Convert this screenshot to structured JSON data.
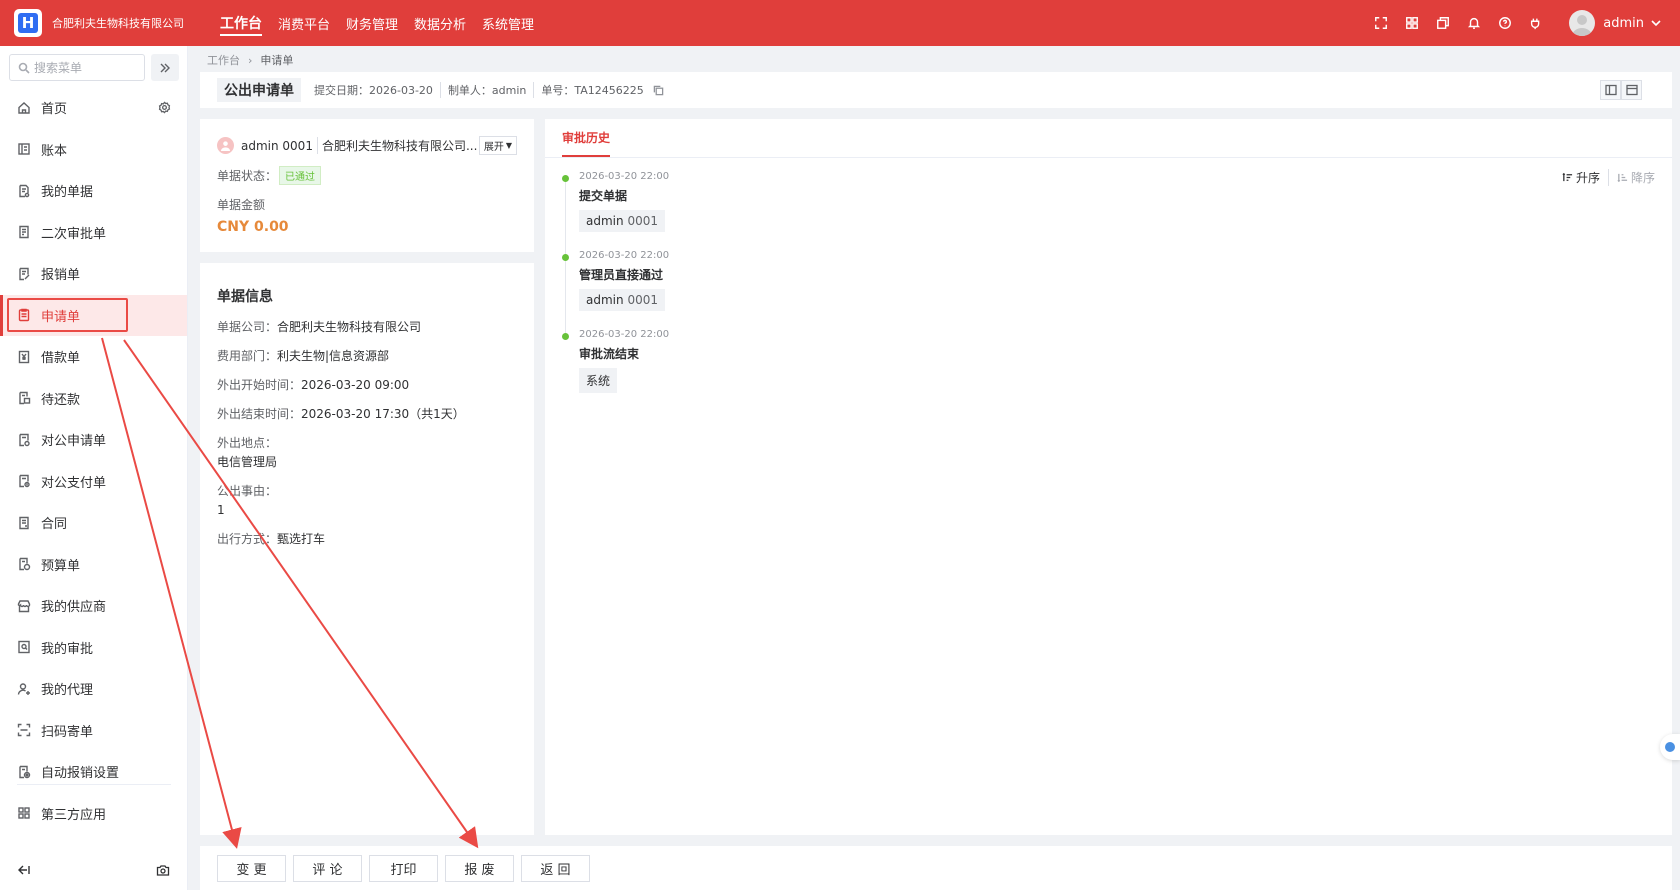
{
  "app": {
    "logo_letter": "H",
    "company": "合肥利夫生物科技有限公司",
    "top_nav": [
      {
        "label": "工作台",
        "active": true
      },
      {
        "label": "消费平台"
      },
      {
        "label": "财务管理"
      },
      {
        "label": "数据分析"
      },
      {
        "label": "系统管理"
      }
    ],
    "top_icons": [
      "fullscreen-icon",
      "apps-grid-icon",
      "windows-icon",
      "bell-icon",
      "help-icon",
      "plugin-icon"
    ],
    "user": "admin",
    "brand_color": "#e03e3b"
  },
  "sidebar": {
    "search_placeholder": "搜索菜单",
    "items": [
      {
        "label": "首页",
        "icon": "home-icon"
      },
      {
        "label": "账本",
        "icon": "ledger-icon"
      },
      {
        "label": "我的单据",
        "icon": "my-docs-icon"
      },
      {
        "label": "二次审批单",
        "icon": "second-approval-icon"
      },
      {
        "label": "报销单",
        "icon": "reimbursement-icon"
      },
      {
        "label": "申请单",
        "icon": "application-icon",
        "active": true
      },
      {
        "label": "借款单",
        "icon": "loan-icon"
      },
      {
        "label": "待还款",
        "icon": "repayment-icon"
      },
      {
        "label": "对公申请单",
        "icon": "corp-application-icon"
      },
      {
        "label": "对公支付单",
        "icon": "corp-payment-icon"
      },
      {
        "label": "合同",
        "icon": "contract-icon"
      },
      {
        "label": "预算单",
        "icon": "budget-icon"
      },
      {
        "label": "我的供应商",
        "icon": "supplier-icon"
      },
      {
        "label": "我的审批",
        "icon": "my-approval-icon"
      },
      {
        "label": "我的代理",
        "icon": "proxy-icon"
      },
      {
        "label": "扫码寄单",
        "icon": "scan-icon"
      },
      {
        "label": "自动报销设置",
        "icon": "auto-reimburse-icon"
      },
      {
        "label": "第三方应用",
        "icon": "third-party-icon"
      }
    ]
  },
  "breadcrumb": [
    "工作台",
    "申请单"
  ],
  "doc": {
    "title": "公出申请单",
    "submit_date": "提交日期：2026-03-20",
    "maker": "制单人：admin",
    "number": "单号：TA12456225"
  },
  "summary": {
    "user": "admin 0001",
    "company": "合肥利夫生物科技有限公司...",
    "toggle": "展开",
    "status_label": "单据状态：",
    "status": "已通过",
    "amount_label": "单据金额",
    "amount": "CNY 0.00",
    "status_color": "#67c23a",
    "amount_color": "#e6893a"
  },
  "info": {
    "title": "单据信息",
    "rows": [
      {
        "k": "单据公司：",
        "v": "合肥利夫生物科技有限公司",
        "inline": true
      },
      {
        "k": "费用部门：",
        "v": "利夫生物|信息资源部",
        "inline": true
      },
      {
        "k": "外出开始时间：",
        "v": "2026-03-20 09:00",
        "inline": true
      },
      {
        "k": "外出结束时间：",
        "v": "2026-03-20 17:30（共1天）",
        "inline": true
      },
      {
        "k": "外出地点：",
        "v": "电信管理局",
        "inline": false
      },
      {
        "k": "公出事由：",
        "v": "1",
        "inline": false
      },
      {
        "k": "出行方式：",
        "v": "甄选打车",
        "inline": true
      }
    ]
  },
  "history": {
    "tab": "审批历史",
    "sort_asc": "升序",
    "sort_desc": "降序",
    "items": [
      {
        "time": "2026-03-20 22:00",
        "title": "提交单据",
        "actor": "admin",
        "actor_id": "0001"
      },
      {
        "time": "2026-03-20 22:00",
        "title": "管理员直接通过",
        "actor": "admin",
        "actor_id": "0001"
      },
      {
        "time": "2026-03-20 22:00",
        "title": "审批流结束",
        "actor": "系统",
        "actor_id": ""
      }
    ]
  },
  "footer": {
    "buttons": [
      "变 更",
      "评 论",
      "打印",
      "报 废",
      "返 回"
    ]
  }
}
